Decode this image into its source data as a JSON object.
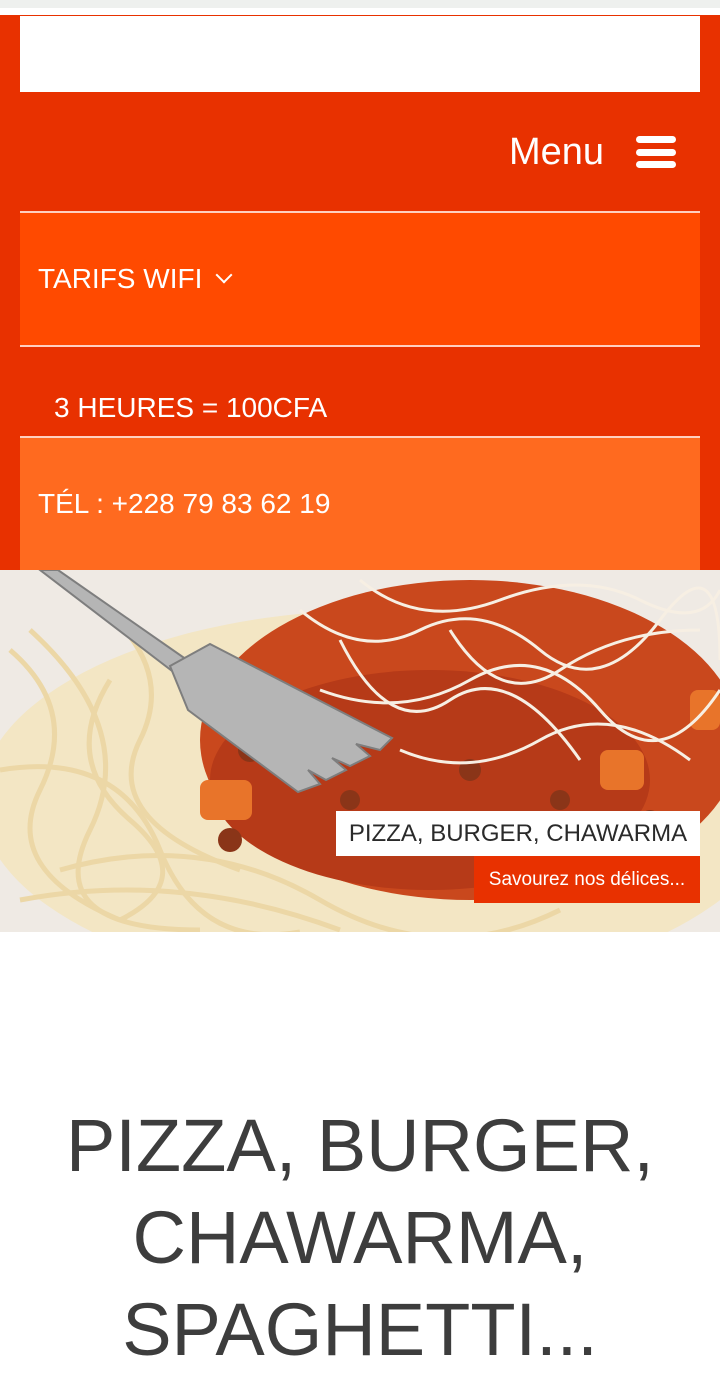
{
  "header": {
    "menu_label": "Menu",
    "nav": {
      "wifi_label": "TARIFS WIFI",
      "wifi_rate": "3 HEURES = 100CFA",
      "phone": "TÉL : +228 79 83 62 19"
    }
  },
  "hero": {
    "caption_title": "PIZZA, BURGER, CHAWARMA",
    "caption_button": "Savourez nos délices..."
  },
  "main": {
    "heading_line1": "PIZZA, BURGER,",
    "heading_line2": "CHAWARMA,",
    "heading_line3": "SPAGHETTI..."
  },
  "colors": {
    "brand_red": "#e83100",
    "nav_orange": "#ff4a00",
    "nav_light_orange": "#ff6a1f"
  }
}
